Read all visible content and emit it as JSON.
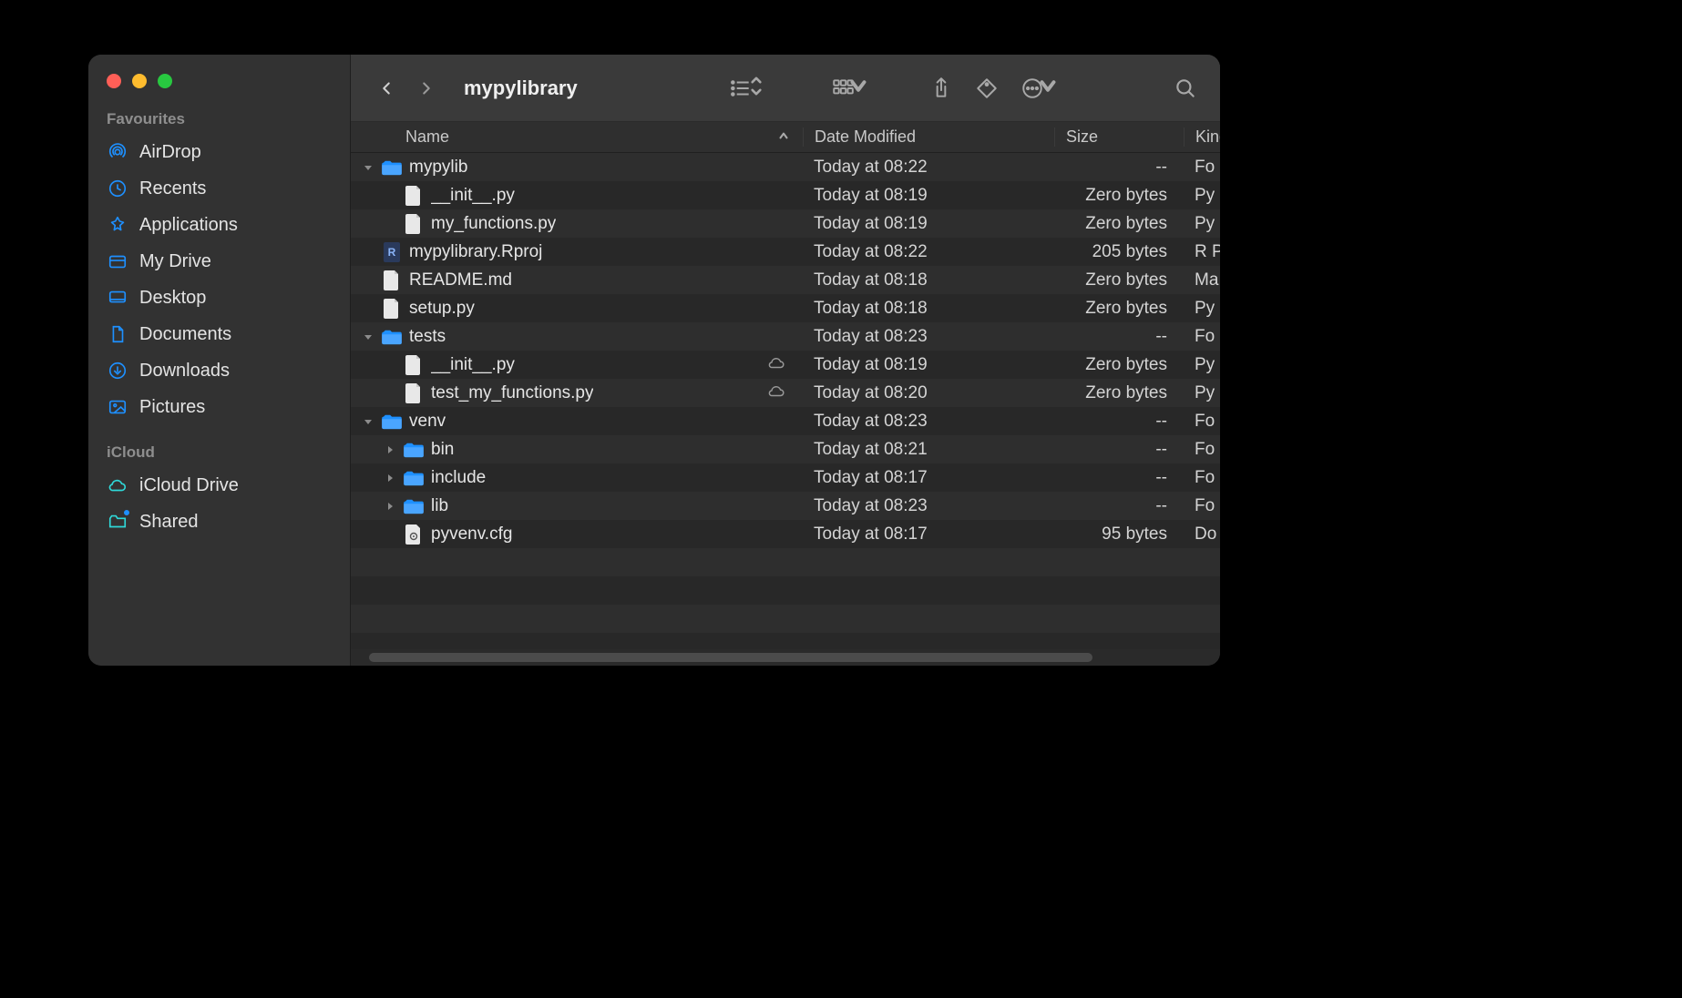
{
  "window": {
    "title": "mypylibrary"
  },
  "sidebar": {
    "sections": [
      {
        "label": "Favourites",
        "items": [
          {
            "id": "airdrop",
            "label": "AirDrop",
            "icon": "airdrop"
          },
          {
            "id": "recents",
            "label": "Recents",
            "icon": "clock"
          },
          {
            "id": "applications",
            "label": "Applications",
            "icon": "apps"
          },
          {
            "id": "mydrive",
            "label": "My Drive",
            "icon": "drive"
          },
          {
            "id": "desktop",
            "label": "Desktop",
            "icon": "desktop"
          },
          {
            "id": "documents",
            "label": "Documents",
            "icon": "doc"
          },
          {
            "id": "downloads",
            "label": "Downloads",
            "icon": "download"
          },
          {
            "id": "pictures",
            "label": "Pictures",
            "icon": "pictures"
          }
        ]
      },
      {
        "label": "iCloud",
        "items": [
          {
            "id": "iclouddrive",
            "label": "iCloud Drive",
            "icon": "cloud",
            "teal": true
          },
          {
            "id": "shared",
            "label": "Shared",
            "icon": "sharedfolder",
            "teal": true,
            "badge": true
          }
        ]
      }
    ]
  },
  "columns": {
    "name": "Name",
    "date": "Date Modified",
    "size": "Size",
    "kind": "Kind"
  },
  "rows": [
    {
      "indent": 0,
      "disclosure": "down",
      "icon": "folder",
      "name": "mypylib",
      "date": "Today at 08:22",
      "size": "--",
      "kind": "Fo",
      "cloud": false
    },
    {
      "indent": 1,
      "disclosure": "none",
      "icon": "file",
      "name": "__init__.py",
      "date": "Today at 08:19",
      "size": "Zero bytes",
      "kind": "Py",
      "cloud": false
    },
    {
      "indent": 1,
      "disclosure": "none",
      "icon": "file",
      "name": "my_functions.py",
      "date": "Today at 08:19",
      "size": "Zero bytes",
      "kind": "Py",
      "cloud": false
    },
    {
      "indent": 0,
      "disclosure": "none",
      "icon": "rproj",
      "name": "mypylibrary.Rproj",
      "date": "Today at 08:22",
      "size": "205 bytes",
      "kind": "R P",
      "cloud": false
    },
    {
      "indent": 0,
      "disclosure": "none",
      "icon": "file",
      "name": "README.md",
      "date": "Today at 08:18",
      "size": "Zero bytes",
      "kind": "Ma",
      "cloud": false
    },
    {
      "indent": 0,
      "disclosure": "none",
      "icon": "file",
      "name": "setup.py",
      "date": "Today at 08:18",
      "size": "Zero bytes",
      "kind": "Py",
      "cloud": false
    },
    {
      "indent": 0,
      "disclosure": "down",
      "icon": "folder",
      "name": "tests",
      "date": "Today at 08:23",
      "size": "--",
      "kind": "Fo",
      "cloud": false
    },
    {
      "indent": 1,
      "disclosure": "none",
      "icon": "file",
      "name": "__init__.py",
      "date": "Today at 08:19",
      "size": "Zero bytes",
      "kind": "Py",
      "cloud": true
    },
    {
      "indent": 1,
      "disclosure": "none",
      "icon": "file",
      "name": "test_my_functions.py",
      "date": "Today at 08:20",
      "size": "Zero bytes",
      "kind": "Py",
      "cloud": true
    },
    {
      "indent": 0,
      "disclosure": "down",
      "icon": "folder",
      "name": "venv",
      "date": "Today at 08:23",
      "size": "--",
      "kind": "Fo",
      "cloud": false
    },
    {
      "indent": 1,
      "disclosure": "right",
      "icon": "folder",
      "name": "bin",
      "date": "Today at 08:21",
      "size": "--",
      "kind": "Fo",
      "cloud": false
    },
    {
      "indent": 1,
      "disclosure": "right",
      "icon": "folder",
      "name": "include",
      "date": "Today at 08:17",
      "size": "--",
      "kind": "Fo",
      "cloud": false
    },
    {
      "indent": 1,
      "disclosure": "right",
      "icon": "folder",
      "name": "lib",
      "date": "Today at 08:23",
      "size": "--",
      "kind": "Fo",
      "cloud": false
    },
    {
      "indent": 1,
      "disclosure": "none",
      "icon": "cfg",
      "name": "pyvenv.cfg",
      "date": "Today at 08:17",
      "size": "95 bytes",
      "kind": "Do",
      "cloud": false
    }
  ]
}
